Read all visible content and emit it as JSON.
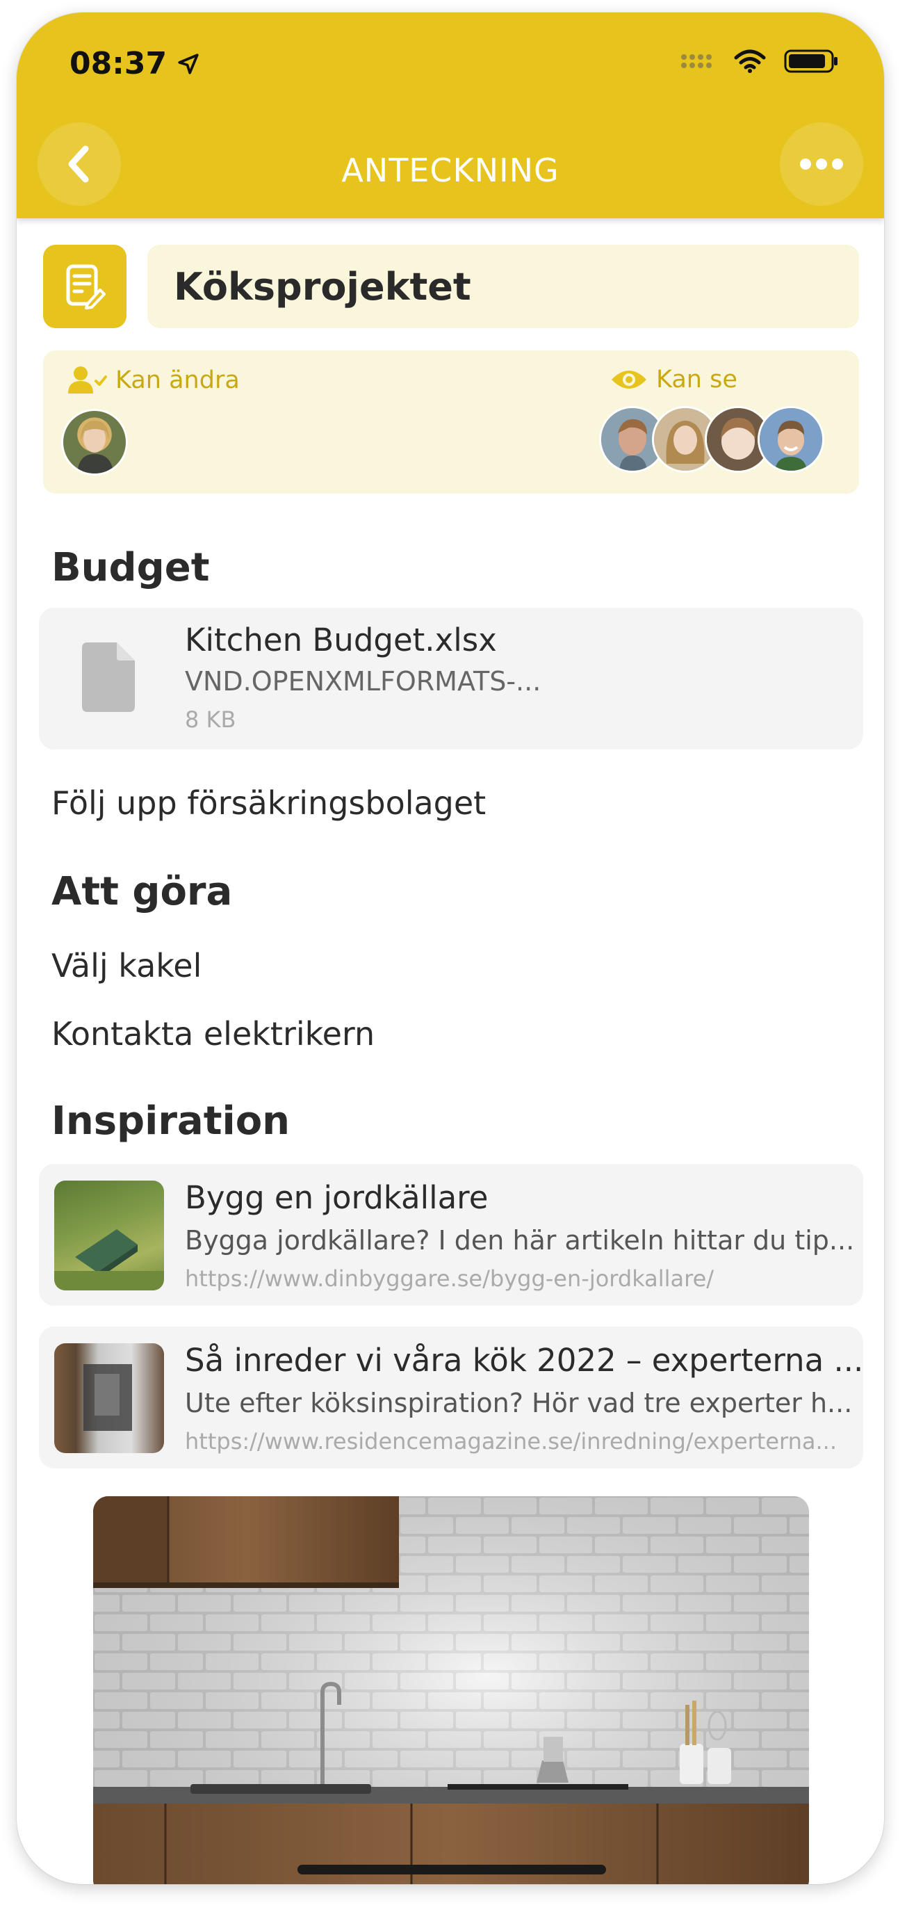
{
  "status_bar": {
    "time": "08:37"
  },
  "header": {
    "title": "ANTECKNING"
  },
  "note": {
    "title": "Köksprojektet"
  },
  "permissions": {
    "can_edit_label": "Kan ändra",
    "can_view_label": "Kan se"
  },
  "sections": {
    "budget": {
      "heading": "Budget",
      "file": {
        "name": "Kitchen Budget.xlsx",
        "type": "VND.OPENXMLFORMATS-...",
        "size": "8 KB"
      },
      "text": "Följ upp försäkringsbolaget"
    },
    "todo": {
      "heading": "Att göra",
      "items": [
        "Välj kakel",
        "Kontakta elektrikern"
      ]
    },
    "inspiration": {
      "heading": "Inspiration",
      "links": [
        {
          "title": "Bygg en jordkällare",
          "description": "Bygga jordkällare? I den här artikeln hittar du tip...",
          "url": "https://www.dinbyggare.se/bygg-en-jordkallare/"
        },
        {
          "title": "Så inreder vi våra kök 2022 – experterna ...",
          "description": "Ute efter köksinspiration? Hör vad tre experter h...",
          "url": "https://www.residencemagazine.se/inredning/experterna..."
        }
      ]
    }
  },
  "colors": {
    "accent": "#e6c31d",
    "accent_light": "#faf6dc",
    "label": "#c9a815"
  }
}
